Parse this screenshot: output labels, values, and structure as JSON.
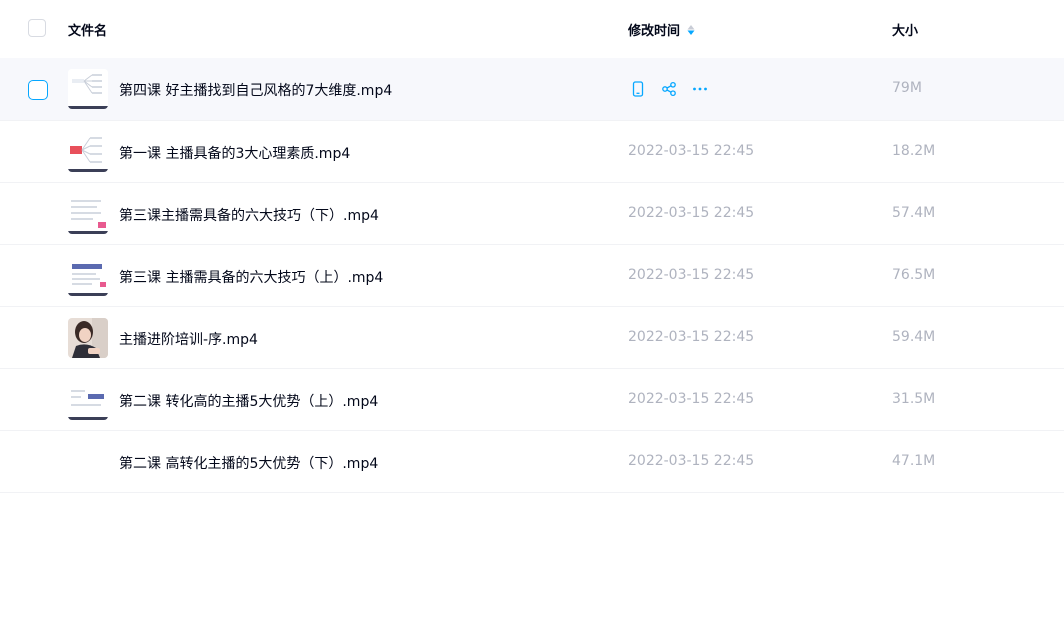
{
  "header": {
    "name_label": "文件名",
    "time_label": "修改时间",
    "size_label": "大小"
  },
  "colors": {
    "accent": "#06a7ff",
    "text": "#03081a",
    "muted": "#afb3bf",
    "hover_bg": "#f7f8fc"
  },
  "files": [
    {
      "name": "第四课 好主播找到自己风格的7大维度.mp4",
      "time": "",
      "size": "79M",
      "thumb": "mindmap-icon",
      "hover": true
    },
    {
      "name": "第一课 主播具备的3大心理素质.mp4",
      "time": "2022-03-15 22:45",
      "size": "18.2M",
      "thumb": "mindmap-icon",
      "hover": false
    },
    {
      "name": "第三课主播需具备的六大技巧（下）.mp4",
      "time": "2022-03-15 22:45",
      "size": "57.4M",
      "thumb": "slide-icon",
      "hover": false
    },
    {
      "name": "第三课 主播需具备的六大技巧（上）.mp4",
      "time": "2022-03-15 22:45",
      "size": "76.5M",
      "thumb": "slide-icon",
      "hover": false
    },
    {
      "name": "主播进阶培训-序.mp4",
      "time": "2022-03-15 22:45",
      "size": "59.4M",
      "thumb": "photo-icon",
      "hover": false
    },
    {
      "name": "第二课 转化高的主播5大优势（上）.mp4",
      "time": "2022-03-15 22:45",
      "size": "31.5M",
      "thumb": "slide-icon",
      "hover": false
    },
    {
      "name": "第二课 高转化主播的5大优势（下）.mp4",
      "time": "2022-03-15 22:45",
      "size": "47.1M",
      "thumb": "",
      "hover": false
    }
  ]
}
